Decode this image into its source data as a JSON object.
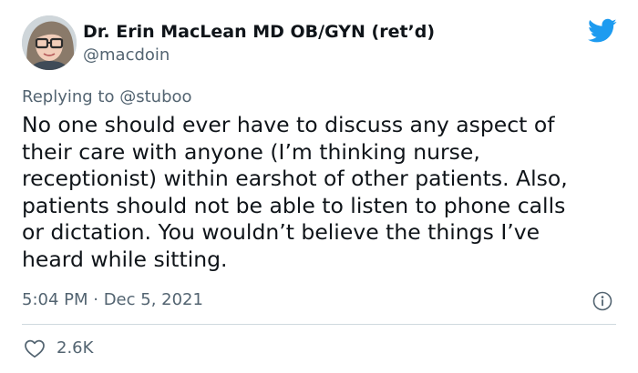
{
  "author": {
    "display_name": "Dr. Erin MacLean MD OB/GYN (ret’d)",
    "handle": "@macdoin"
  },
  "reply": {
    "prefix": "Replying to",
    "mention": "@stuboo"
  },
  "tweet": {
    "lines": [
      "No one should ever have to discuss any aspect of",
      "their care with anyone (I’m thinking nurse,",
      "receptionist) within earshot of other patients. Also,",
      "patients should not be able to listen to phone calls",
      "or dictation. You wouldn’t believe the things I’ve",
      "heard while sitting."
    ],
    "timestamp": "5:04 PM · Dec 5, 2021"
  },
  "engagement": {
    "likes": "2.6K"
  },
  "icons": {
    "brand": "twitter-bird-icon",
    "info": "info-icon",
    "like": "heart-icon"
  },
  "colors": {
    "brand": "#1d9bf0",
    "text": "#0f1419",
    "secondary": "#536471",
    "divider": "#cfd9de"
  }
}
